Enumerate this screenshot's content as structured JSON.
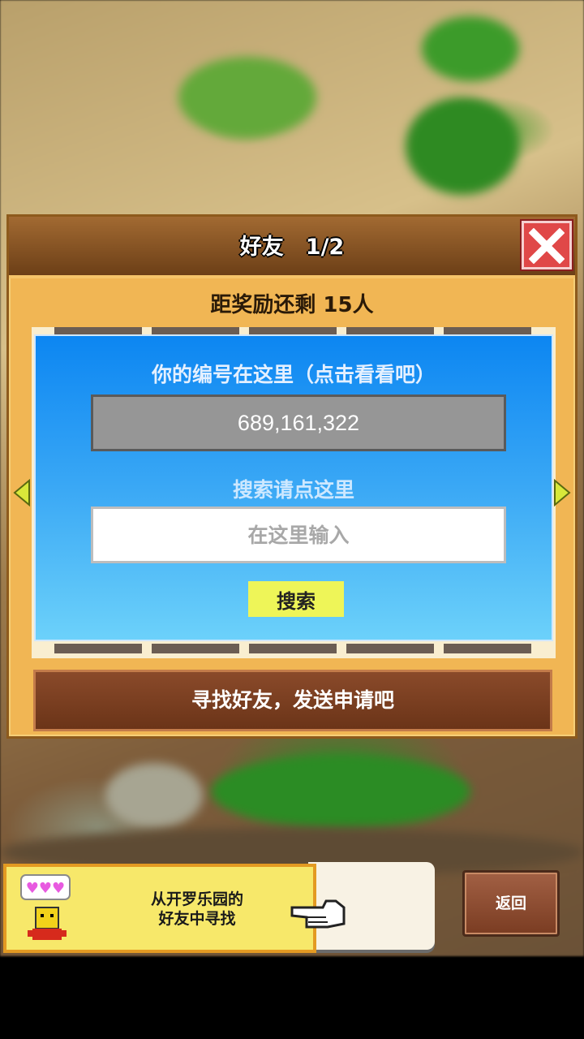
{
  "dialog": {
    "title": "好友　1/2",
    "reward_text": "距奖励还剩 15人",
    "id_label": "你的编号在这里（点击看看吧）",
    "player_id": "689,161,322",
    "search_label": "搜索请点这里",
    "search_placeholder": "在这里输入",
    "search_button": "搜索",
    "find_friends_button": "寻找好友，发送申请吧"
  },
  "bottom": {
    "banner_line1": "从开罗乐园的",
    "banner_line2": "好友中寻找",
    "back_button": "返回"
  },
  "colors": {
    "dialog_bg": "#f1b654",
    "panel_blue_top": "#0c86f2",
    "panel_blue_bottom": "#6cd1fa",
    "search_button": "#eef558",
    "close_button": "#e04848",
    "brown_button": "#7a3c22"
  },
  "icons": [
    "close-icon",
    "arrow-left-icon",
    "arrow-right-icon",
    "pointing-hand-icon",
    "character-icon",
    "hearts-icon"
  ]
}
